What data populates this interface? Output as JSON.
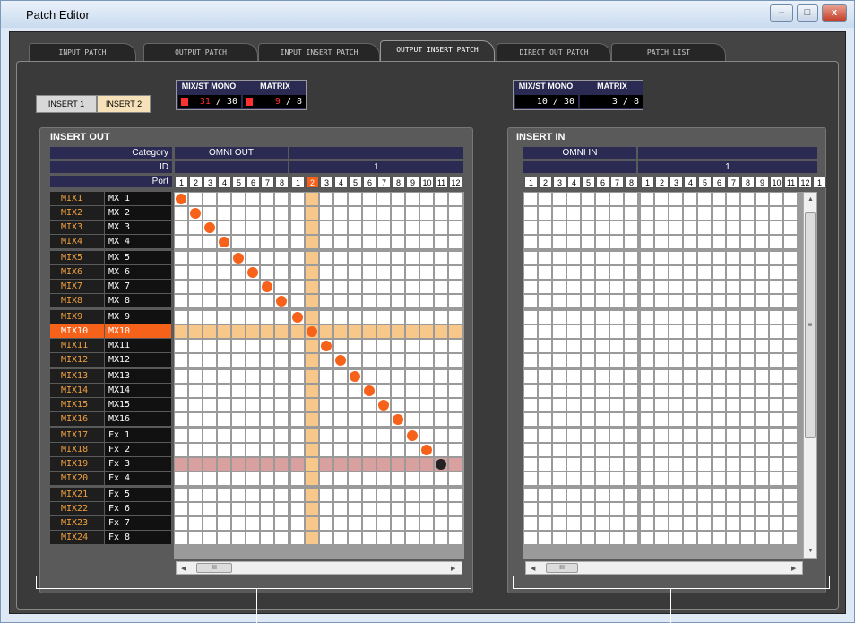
{
  "window": {
    "title": "Patch Editor",
    "minimize": "–",
    "maximize": "□",
    "close": "x"
  },
  "tabs": [
    {
      "label": "INPUT PATCH",
      "active": false
    },
    {
      "label": "OUTPUT PATCH",
      "active": false
    },
    {
      "label": "INPUT INSERT PATCH",
      "active": false
    },
    {
      "label": "OUTPUT INSERT PATCH",
      "active": true
    },
    {
      "label": "DIRECT OUT PATCH",
      "active": false
    },
    {
      "label": "PATCH LIST",
      "active": false
    }
  ],
  "insert_buttons": {
    "insert1": "INSERT 1",
    "insert2": "INSERT 2",
    "selected": "insert2"
  },
  "counter_out": {
    "label1": "MIX/ST MONO",
    "label2": "MATRIX",
    "value1": "31",
    "max1": "/ 30",
    "value2": "9",
    "max2": "/ 8"
  },
  "counter_in": {
    "label1": "MIX/ST MONO",
    "label2": "MATRIX",
    "value1": "10 / 30",
    "value2": "3 / 8"
  },
  "insert_out": {
    "title": "INSERT OUT",
    "category_label": "Category",
    "id_label": "ID",
    "port_label": "Port",
    "category_value": "OMNI OUT",
    "id_value": "1",
    "omni_ports": [
      "1",
      "2",
      "3",
      "4",
      "5",
      "6",
      "7",
      "8"
    ],
    "slot_ports": [
      "1",
      "2",
      "3",
      "4",
      "5",
      "6",
      "7",
      "8",
      "9",
      "10",
      "11",
      "12"
    ],
    "highlight_port": "2",
    "selected_row": "MIX10",
    "error_row": "MIX19",
    "rows": [
      {
        "ch": "MIX1",
        "name": "MX 1"
      },
      {
        "ch": "MIX2",
        "name": "MX 2"
      },
      {
        "ch": "MIX3",
        "name": "MX 3"
      },
      {
        "ch": "MIX4",
        "name": "MX 4"
      },
      {
        "ch": "MIX5",
        "name": "MX 5"
      },
      {
        "ch": "MIX6",
        "name": "MX 6"
      },
      {
        "ch": "MIX7",
        "name": "MX 7"
      },
      {
        "ch": "MIX8",
        "name": "MX 8"
      },
      {
        "ch": "MIX9",
        "name": "MX 9"
      },
      {
        "ch": "MIX10",
        "name": "MX10"
      },
      {
        "ch": "MIX11",
        "name": "MX11"
      },
      {
        "ch": "MIX12",
        "name": "MX12"
      },
      {
        "ch": "MIX13",
        "name": "MX13"
      },
      {
        "ch": "MIX14",
        "name": "MX14"
      },
      {
        "ch": "MIX15",
        "name": "MX15"
      },
      {
        "ch": "MIX16",
        "name": "MX16"
      },
      {
        "ch": "MIX17",
        "name": "Fx 1"
      },
      {
        "ch": "MIX18",
        "name": "Fx 2"
      },
      {
        "ch": "MIX19",
        "name": "Fx 3"
      },
      {
        "ch": "MIX20",
        "name": "Fx 4"
      },
      {
        "ch": "MIX21",
        "name": "Fx 5"
      },
      {
        "ch": "MIX22",
        "name": "Fx 6"
      },
      {
        "ch": "MIX23",
        "name": "Fx 7"
      },
      {
        "ch": "MIX24",
        "name": "Fx 8"
      }
    ],
    "patches": [
      {
        "row": 0,
        "col": 0
      },
      {
        "row": 1,
        "col": 1
      },
      {
        "row": 2,
        "col": 2
      },
      {
        "row": 3,
        "col": 3
      },
      {
        "row": 4,
        "col": 4
      },
      {
        "row": 5,
        "col": 5
      },
      {
        "row": 6,
        "col": 6
      },
      {
        "row": 7,
        "col": 7
      },
      {
        "row": 8,
        "col": 8
      },
      {
        "row": 9,
        "col": 9
      },
      {
        "row": 10,
        "col": 10
      },
      {
        "row": 11,
        "col": 11
      },
      {
        "row": 12,
        "col": 12
      },
      {
        "row": 13,
        "col": 13
      },
      {
        "row": 14,
        "col": 14
      },
      {
        "row": 15,
        "col": 15
      },
      {
        "row": 16,
        "col": 16
      },
      {
        "row": 17,
        "col": 17
      },
      {
        "row": 18,
        "col": 18,
        "state": "dark"
      }
    ],
    "scroll_thumb": "III"
  },
  "insert_in": {
    "title": "INSERT IN",
    "category_value": "OMNI IN",
    "id_value": "1",
    "omni_ports": [
      "1",
      "2",
      "3",
      "4",
      "5",
      "6",
      "7",
      "8"
    ],
    "slot_ports": [
      "1",
      "2",
      "3",
      "4",
      "5",
      "6",
      "7",
      "8",
      "9",
      "10",
      "11",
      "12",
      "1"
    ],
    "scroll_thumb": "III",
    "vscroll_thumb": "≡"
  },
  "colors": {
    "accent": "#f7621b",
    "highlight": "#f7c88a",
    "error_row": "#d9a0a0",
    "header": "#2a2a52"
  }
}
